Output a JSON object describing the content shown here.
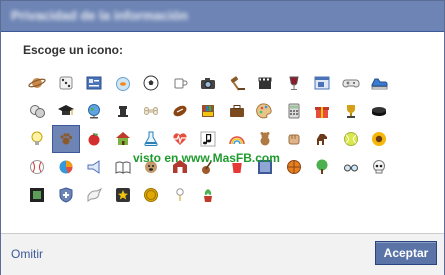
{
  "dialog": {
    "title": "Privacidad de la información",
    "prompt": "Escoge un icono:",
    "watermark": "visto en www.MasFB.com"
  },
  "footer": {
    "skip_label": "Omitir",
    "accept_label": "Aceptar"
  },
  "selected_icon": "paw-icon",
  "icons": [
    [
      "planet-icon",
      "dice-icon",
      "contact-card-icon",
      "goldfish-bowl-icon",
      "soccer-ball-icon",
      "coffee-mug-icon",
      "camera-icon",
      "gavel-icon",
      "film-clapper-icon",
      "wine-glass-icon",
      "window-app-icon",
      "gamepad-icon",
      "sneaker-icon"
    ],
    [
      "theater-masks-icon",
      "graduation-cap-icon",
      "globe-icon",
      "chess-rook-icon",
      "bone-icon",
      "football-icon",
      "bookshelf-icon",
      "briefcase-icon",
      "palette-icon",
      "calculator-icon",
      "gift-icon",
      "trophy-icon",
      "hockey-puck-icon"
    ],
    [
      "lightbulb-icon",
      "paw-icon",
      "apple-icon",
      "house-icon",
      "flask-icon",
      "heartbeat-icon",
      "music-note-icon",
      "rainbow-icon",
      "teddy-bear-icon",
      "fist-icon",
      "horse-icon",
      "tennis-ball-icon",
      "sunflower-icon"
    ],
    [
      "baseball-icon",
      "pie-chart-icon",
      "megaphone-icon",
      "open-book-icon",
      "bulldog-icon",
      "barn-icon",
      "guitar-icon",
      "red-cup-icon",
      "blue-square-icon",
      "basketball-icon",
      "tree-icon",
      "glasses-icon",
      "skull-icon"
    ],
    [
      "film-frame-icon",
      "shield-icon",
      "dove-icon",
      "star-badge-icon",
      "coin-icon",
      "golf-tee-icon",
      "plant-pot-icon"
    ]
  ],
  "colors": {
    "header_bg": "#6d84b4",
    "button_bg": "#5b74a8",
    "link": "#3b5998",
    "watermark": "#1f9b2e"
  }
}
